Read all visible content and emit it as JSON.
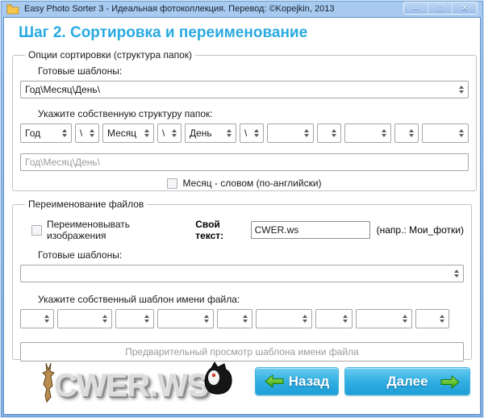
{
  "window": {
    "title": "Easy Photo Sorter 3 - Идеальная фотоколлекция. Перевод: ©Kopejkin, 2013",
    "controls": {
      "minimize": "–",
      "maximize": "□",
      "close": "✕"
    }
  },
  "heading": "Шаг 2. Сортировка и переименование",
  "sorting": {
    "group_title": "Опции сортировки (структура папок)",
    "ready_templates_label": "Готовые шаблоны:",
    "template_value": "Год\\Месяц\\День\\",
    "custom_structure_label": "Укажите собственную структуру папок:",
    "structure": [
      "Год",
      "\\",
      "Месяц",
      "\\",
      "День",
      "\\",
      "",
      "",
      "",
      "",
      ""
    ],
    "structure_preview": "Год\\Месяц\\День\\",
    "month_word_label": "Месяц - словом (по-английски)"
  },
  "renaming": {
    "group_title": "Переименование файлов",
    "rename_checkbox_label": "Переименовывать изображения",
    "own_text_label": "Свой текст:",
    "own_text_value": "CWER.ws",
    "own_text_hint": "(напр.: Мои_фотки)",
    "ready_templates_label": "Готовые шаблоны:",
    "template_value": "",
    "custom_pattern_label": "Укажите собственный шаблон имени файла:",
    "pattern": [
      "",
      "",
      "",
      "",
      "",
      "",
      "",
      "",
      ""
    ],
    "preview_placeholder": "Предварительный просмотр шаблона имени файла"
  },
  "footer": {
    "logo_text": "CWER.WS",
    "back_label": "Назад",
    "next_label": "Далее"
  },
  "colors": {
    "accent_blue": "#29aae1",
    "titlebar_blue": "#8ab5e8",
    "button_blue": "#34b0e3",
    "arrow_green": "#3fae1c"
  }
}
